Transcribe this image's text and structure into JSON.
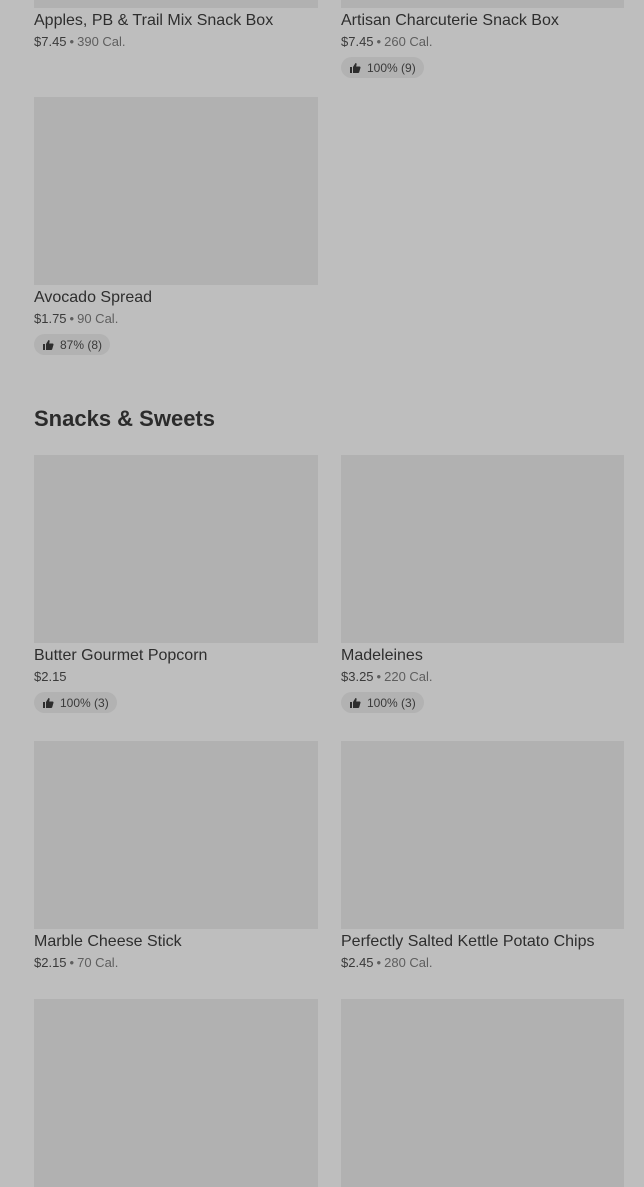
{
  "top_items": [
    {
      "name": "Apples, PB & Trail Mix Snack Box",
      "price": "$7.45",
      "calories": "390 Cal."
    },
    {
      "name": "Artisan Charcuterie Snack Box",
      "price": "$7.45",
      "calories": "260 Cal.",
      "rating": "100% (9)"
    },
    {
      "name": "Avocado Spread",
      "price": "$1.75",
      "calories": "90 Cal.",
      "rating": "87% (8)"
    }
  ],
  "snacks_section": {
    "title": "Snacks & Sweets",
    "items": [
      {
        "name": "Butter Gourmet Popcorn",
        "price": "$2.15",
        "rating": "100% (3)"
      },
      {
        "name": "Madeleines",
        "price": "$3.25",
        "calories": "220 Cal.",
        "rating": "100% (3)"
      },
      {
        "name": "Marble Cheese Stick",
        "price": "$2.15",
        "calories": "70 Cal."
      },
      {
        "name": "Perfectly Salted Kettle Potato Chips",
        "price": "$2.45",
        "calories": "280 Cal."
      }
    ]
  },
  "separator": "•",
  "icons": {
    "rating": "thumbs-up-icon"
  },
  "colors": {
    "background": "#bebebe",
    "image_placeholder": "#b1b1b1",
    "badge": "#b2b2b2"
  }
}
